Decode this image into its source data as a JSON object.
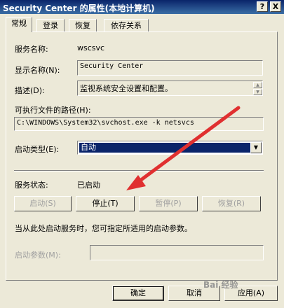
{
  "window": {
    "title": "Security Center 的属性(本地计算机)",
    "help_label": "?",
    "close_label": "X"
  },
  "tabs": [
    {
      "label": "常规"
    },
    {
      "label": "登录"
    },
    {
      "label": "恢复"
    },
    {
      "label": "依存关系"
    }
  ],
  "general": {
    "service_name_label": "服务名称:",
    "service_name_value": "wscsvc",
    "display_name_label": "显示名称(N):",
    "display_name_value": "Security Center",
    "description_label": "描述(D):",
    "description_value": "监视系统安全设置和配置。",
    "exe_path_label": "可执行文件的路径(H):",
    "exe_path_value": "C:\\WINDOWS\\System32\\svchost.exe -k netsvcs",
    "startup_type_label": "启动类型(E):",
    "startup_type_value": "自动",
    "status_label": "服务状态:",
    "status_value": "已启动",
    "hint_text": "当从此处启动服务时，您可指定所适用的启动参数。",
    "params_label": "启动参数(M):",
    "params_value": ""
  },
  "service_buttons": {
    "start": "启动(S)",
    "stop": "停止(T)",
    "pause": "暂停(P)",
    "resume": "恢复(R)"
  },
  "dialog_buttons": {
    "ok": "确定",
    "cancel": "取消",
    "apply": "应用(A)"
  },
  "icons": {
    "scroll_up": "scroll-up-icon",
    "scroll_down": "scroll-down-icon",
    "dropdown": "chevron-down-icon"
  },
  "watermark": "Bai 经验",
  "colors": {
    "title_bar": "#0a246a",
    "selection": "#0a246a",
    "annotation_arrow": "#e03030"
  }
}
